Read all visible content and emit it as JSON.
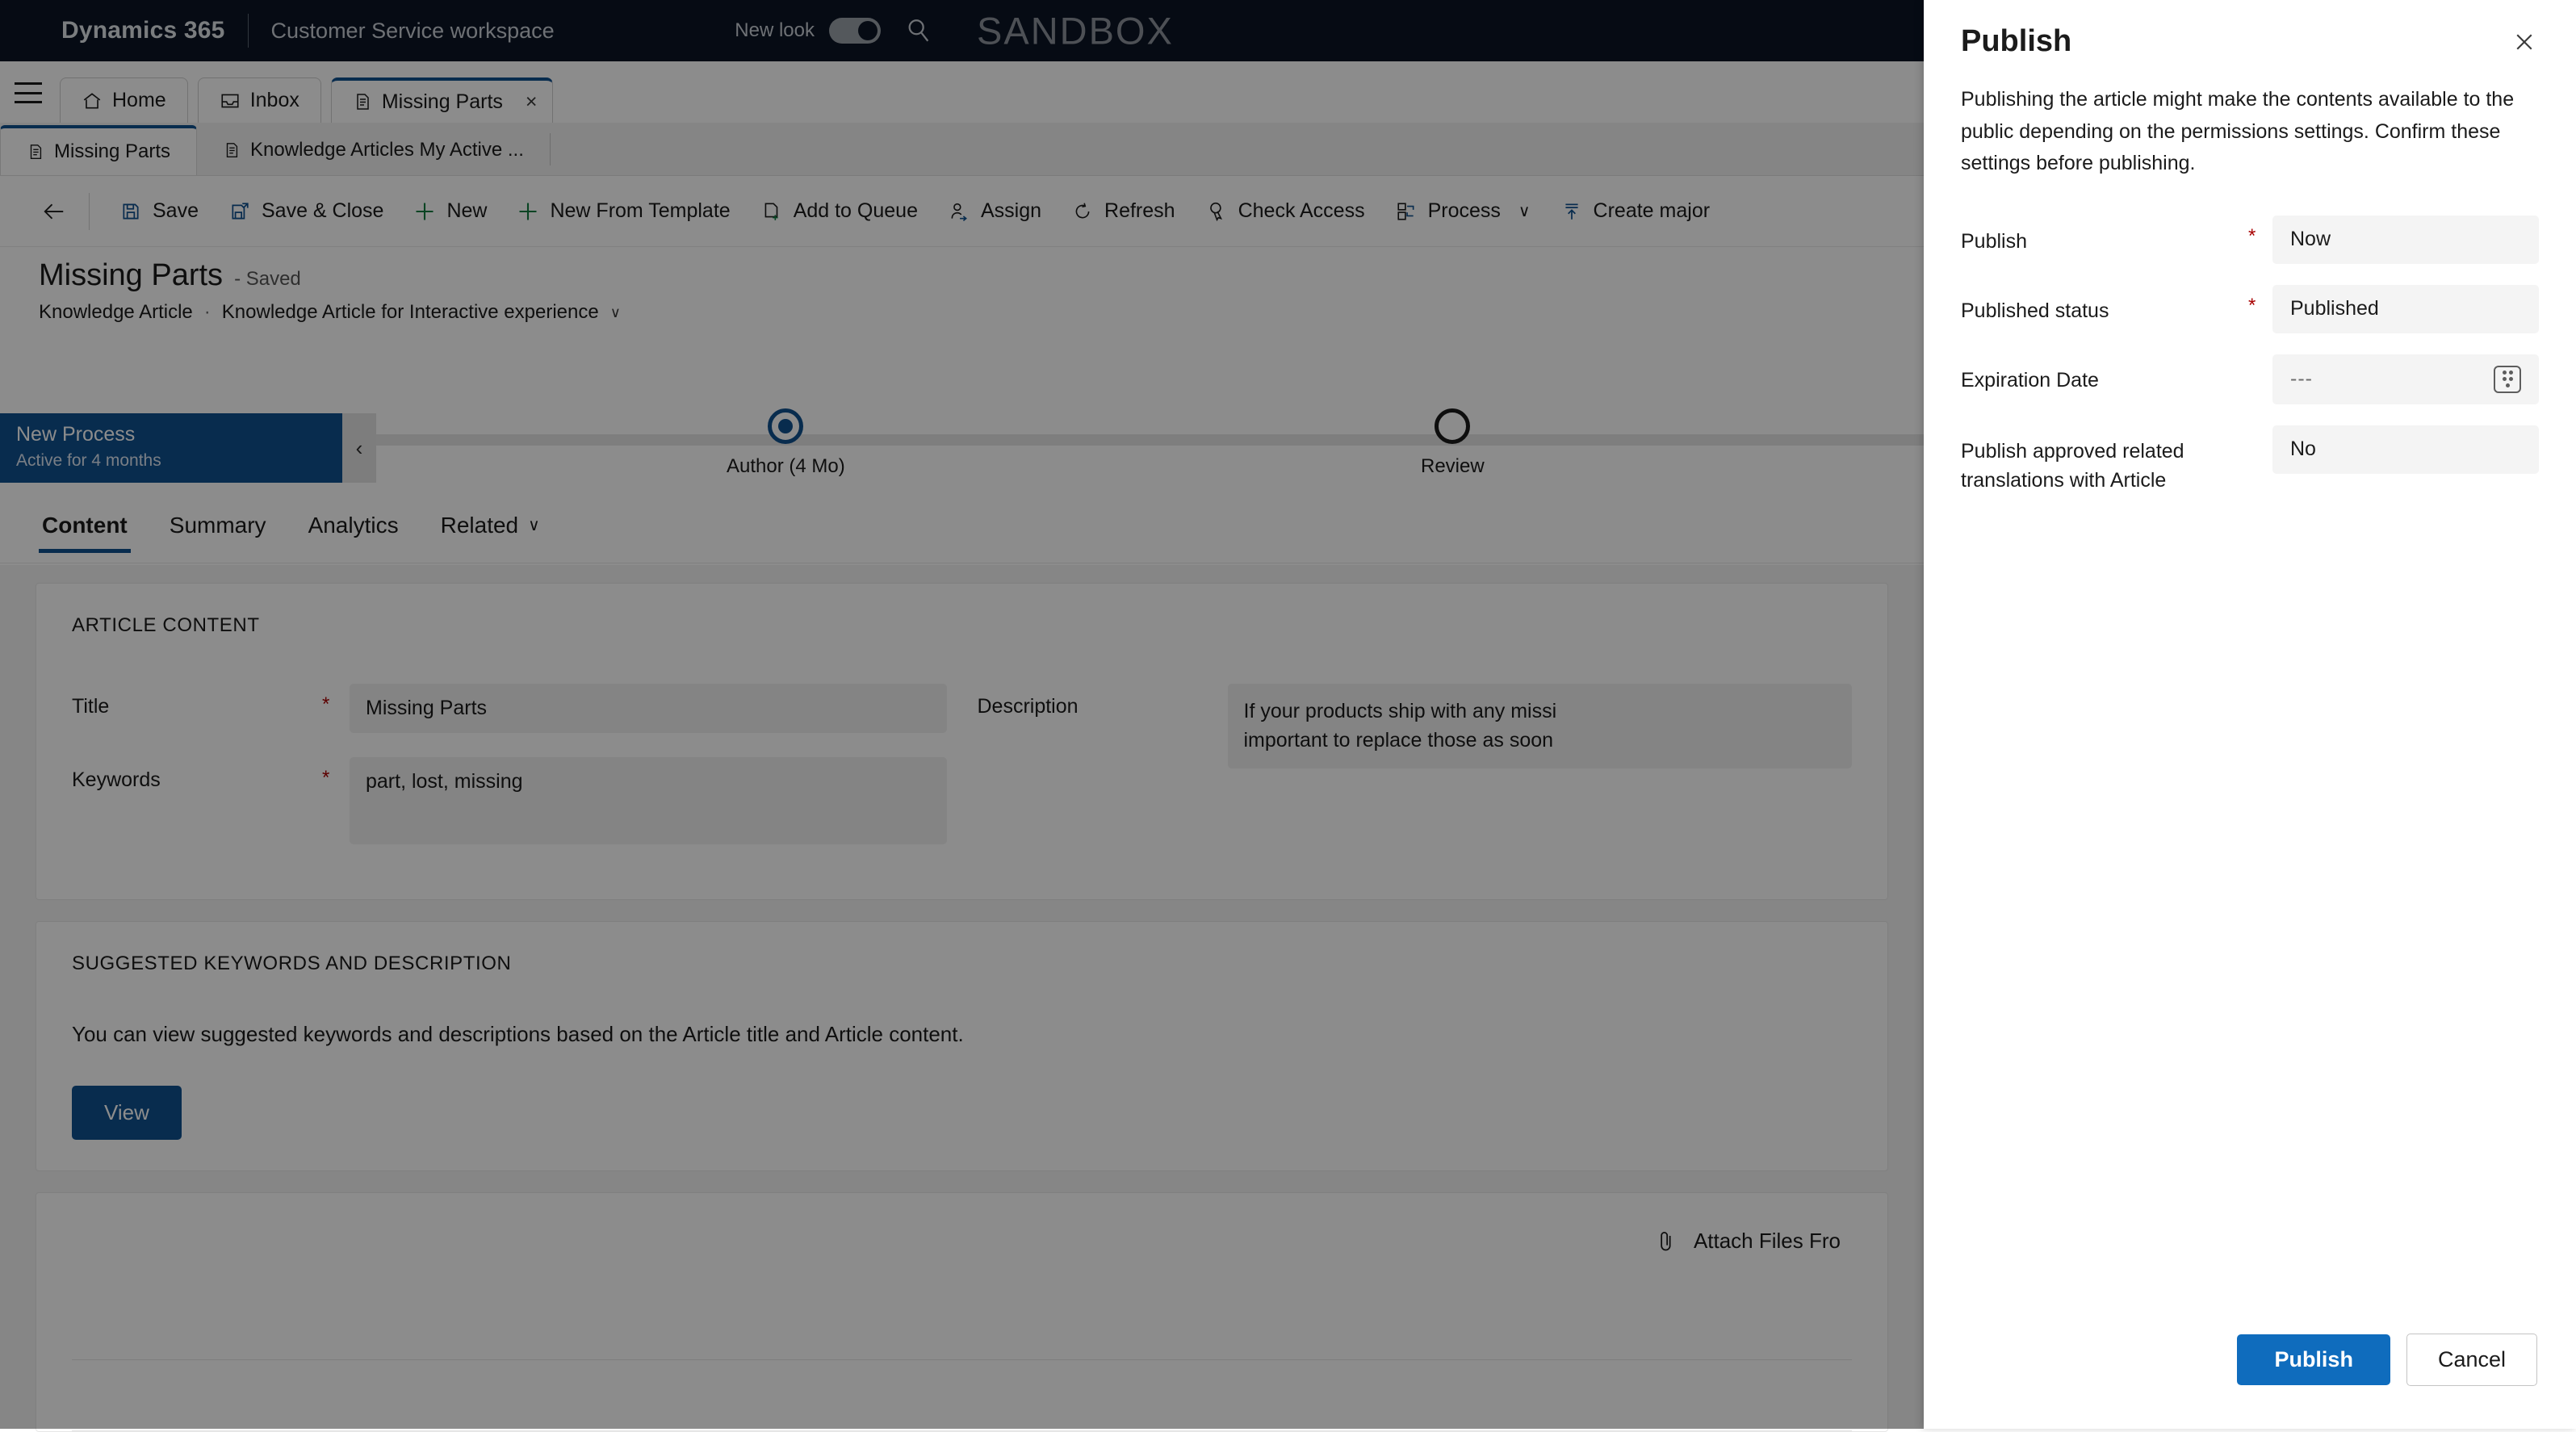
{
  "topbar": {
    "brand": "Dynamics 365",
    "app_name": "Customer Service workspace",
    "environment_banner": "SANDBOX",
    "new_look_label": "New look",
    "new_look_state": "on",
    "search_icon": "search-icon"
  },
  "session_tabs": [
    {
      "label": "Home",
      "icon": "home-icon",
      "active": false
    },
    {
      "label": "Inbox",
      "icon": "inbox-icon",
      "active": false
    },
    {
      "label": "Missing Parts",
      "icon": "document-icon",
      "active": true,
      "close": "×"
    }
  ],
  "app_tabs": [
    {
      "label": "Missing Parts",
      "icon": "document-icon",
      "selected": true
    },
    {
      "label": "Knowledge Articles My Active ...",
      "icon": "document-icon",
      "selected": false
    }
  ],
  "command_bar": {
    "back": "back-arrow-icon",
    "items": [
      {
        "label": "Save",
        "icon": "save-icon"
      },
      {
        "label": "Save & Close",
        "icon": "save-close-icon"
      },
      {
        "label": "New",
        "icon": "plus-icon"
      },
      {
        "label": "New From Template",
        "icon": "plus-icon"
      },
      {
        "label": "Add to Queue",
        "icon": "add-to-queue-icon"
      },
      {
        "label": "Assign",
        "icon": "assign-person-icon"
      },
      {
        "label": "Refresh",
        "icon": "refresh-icon"
      },
      {
        "label": "Check Access",
        "icon": "check-access-icon"
      },
      {
        "label": "Process",
        "icon": "process-icon",
        "chevron": "∨"
      },
      {
        "label": "Create major",
        "icon": "create-major-icon"
      }
    ]
  },
  "record": {
    "title": "Missing Parts",
    "saved_state": "- Saved",
    "entity": "Knowledge Article",
    "separator": "·",
    "form_name": "Knowledge Article for Interactive experience",
    "form_chevron": "∨"
  },
  "process_flow": {
    "stage_title": "New Process",
    "stage_subtitle": "Active for 4 months",
    "collapse_icon": "‹",
    "stages": [
      {
        "label": "Author  (4 Mo)",
        "state": "current"
      },
      {
        "label": "Review",
        "state": "upcoming"
      }
    ]
  },
  "form_tabs": [
    {
      "label": "Content",
      "active": true
    },
    {
      "label": "Summary",
      "active": false
    },
    {
      "label": "Analytics",
      "active": false
    },
    {
      "label": "Related",
      "active": false,
      "chevron": "∨"
    }
  ],
  "article_content": {
    "section_title": "ARTICLE CONTENT",
    "fields": [
      {
        "label": "Title",
        "required": "*",
        "value": "Missing Parts"
      },
      {
        "label": "Keywords",
        "required": "*",
        "value": "part, lost, missing"
      }
    ],
    "description": {
      "label": "Description",
      "value": "If your products ship with any missi\nimportant to replace those as soon"
    }
  },
  "suggested": {
    "section_title": "SUGGESTED KEYWORDS AND DESCRIPTION",
    "help_text": "You can view suggested keywords and descriptions based on the Article title and Article content.",
    "view_button": "View"
  },
  "attachments": {
    "attach_label": "Attach Files Fro",
    "attach_icon": "paperclip-icon"
  },
  "publish_panel": {
    "title": "Publish",
    "close_icon": "✕",
    "description": "Publishing the article might make the contents available to the public depending on the permissions settings. Confirm these settings before publishing.",
    "fields": [
      {
        "label": "Publish",
        "required": "*",
        "value": "Now",
        "type": "select"
      },
      {
        "label": "Published status",
        "required": "*",
        "value": "Published",
        "type": "select"
      },
      {
        "label": "Expiration Date",
        "required": "",
        "value": "---",
        "type": "date",
        "icon": "calendar-icon",
        "placeholder": true
      },
      {
        "label": "Publish approved related translations with Article",
        "required": "",
        "value": "No",
        "type": "select"
      }
    ],
    "primary_button": "Publish",
    "secondary_button": "Cancel"
  },
  "colors": {
    "brand_dark": "#0b1526",
    "accent_blue": "#10508f",
    "primary_button": "#0f6cbd",
    "required_red": "#a80000",
    "field_bg": "#f0f0f0"
  }
}
